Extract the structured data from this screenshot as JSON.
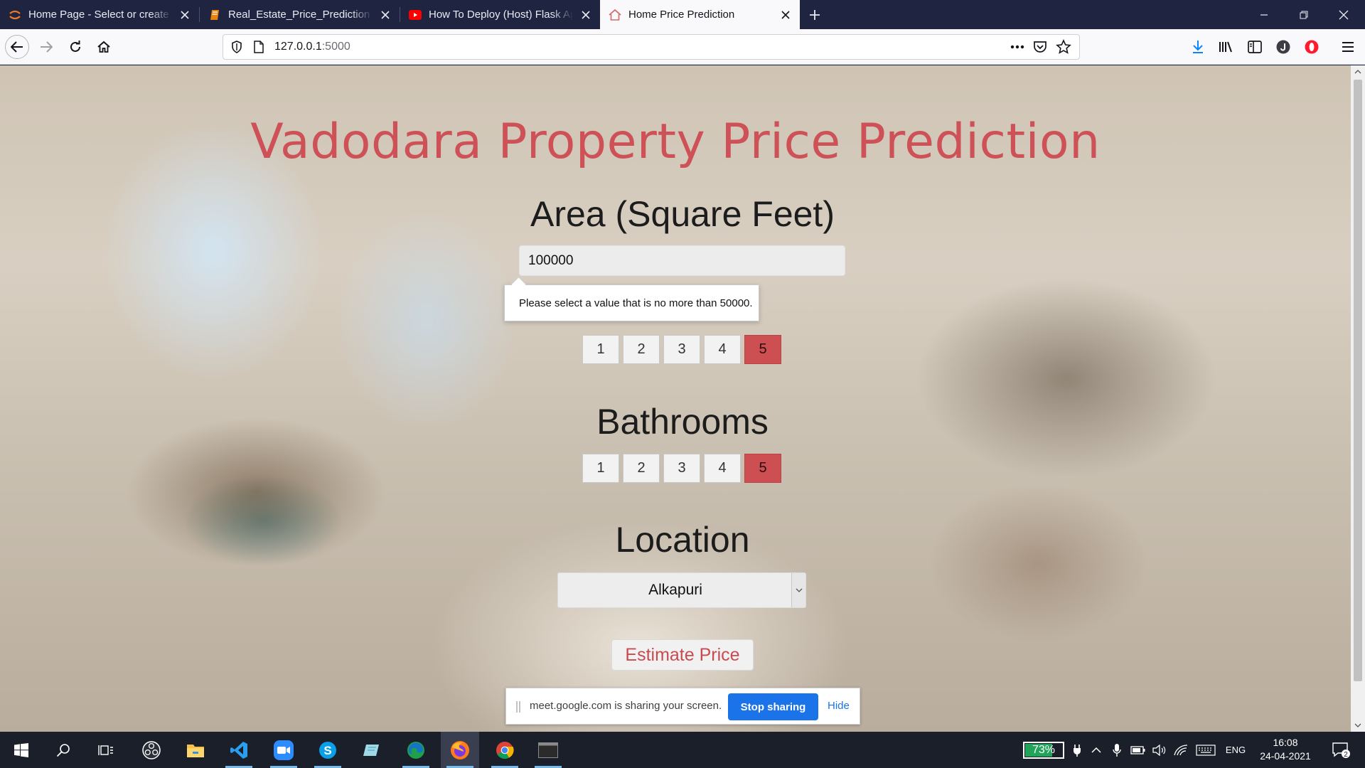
{
  "browser": {
    "tabs": [
      {
        "title": "Home Page - Select or create a",
        "icon": "jupyter-icon",
        "active": false
      },
      {
        "title": "Real_Estate_Price_Prediction - J",
        "icon": "notebook-icon",
        "active": false
      },
      {
        "title": "How To Deploy (Host) Flask Ap",
        "icon": "youtube-icon",
        "active": false
      },
      {
        "title": "Home Price Prediction",
        "icon": "house-icon",
        "active": true
      }
    ],
    "url": {
      "host": "127.0.0.1",
      "port": ":5000"
    }
  },
  "page": {
    "title": "Vadodara Property Price Prediction",
    "area_label": "Area (Square Feet)",
    "area_value": "100000",
    "validation_tooltip": "Please select a value that is no more than 50000.",
    "bhk_options": [
      "1",
      "2",
      "3",
      "4",
      "5"
    ],
    "bhk_selected": "5",
    "bath_label": "Bathrooms",
    "bath_options": [
      "1",
      "2",
      "3",
      "4",
      "5"
    ],
    "bath_selected": "5",
    "location_label": "Location",
    "location_value": "Alkapuri",
    "estimate_label": "Estimate Price"
  },
  "sharing": {
    "text": "meet.google.com is sharing your screen.",
    "stop_label": "Stop sharing",
    "hide_label": "Hide"
  },
  "taskbar": {
    "battery_percent": "73%",
    "battery_level": 0.73,
    "language": "ENG",
    "time": "16:08",
    "date": "24-04-2021",
    "notifications": "2"
  },
  "colors": {
    "accent_red": "#cd5157",
    "share_blue": "#1a73e8",
    "titlebar": "#1f2541"
  }
}
